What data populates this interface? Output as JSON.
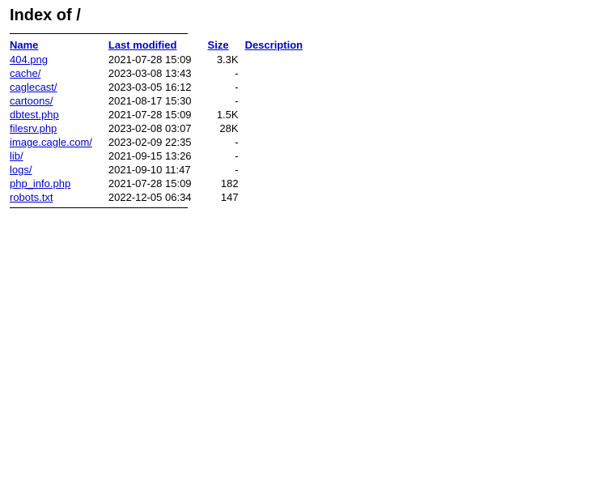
{
  "page": {
    "title": "Index of /"
  },
  "columns": {
    "name": "Name",
    "last_modified": "Last modified",
    "size": "Size",
    "description": "Description"
  },
  "files": [
    {
      "name": "404.png",
      "href": "404.png",
      "last_modified": "2021-07-28 15:09",
      "size": "3.3K",
      "description": ""
    },
    {
      "name": "cache/",
      "href": "cache/",
      "last_modified": "2023-03-08 13:43",
      "size": "-",
      "description": ""
    },
    {
      "name": "caglecast/",
      "href": "caglecast/",
      "last_modified": "2023-03-05 16:12",
      "size": "-",
      "description": ""
    },
    {
      "name": "cartoons/",
      "href": "cartoons/",
      "last_modified": "2021-08-17 15:30",
      "size": "-",
      "description": ""
    },
    {
      "name": "dbtest.php",
      "href": "dbtest.php",
      "last_modified": "2021-07-28 15:09",
      "size": "1.5K",
      "description": ""
    },
    {
      "name": "filesrv.php",
      "href": "filesrv.php",
      "last_modified": "2023-02-08 03:07",
      "size": "28K",
      "description": ""
    },
    {
      "name": "image.cagle.com/",
      "href": "image.cagle.com/",
      "last_modified": "2023-02-09 22:35",
      "size": "-",
      "description": ""
    },
    {
      "name": "lib/",
      "href": "lib/",
      "last_modified": "2021-09-15 13:26",
      "size": "-",
      "description": ""
    },
    {
      "name": "logs/",
      "href": "logs/",
      "last_modified": "2021-09-10 11:47",
      "size": "-",
      "description": ""
    },
    {
      "name": "php_info.php",
      "href": "php_info.php",
      "last_modified": "2021-07-28 15:09",
      "size": "182",
      "description": ""
    },
    {
      "name": "robots.txt",
      "href": "robots.txt",
      "last_modified": "2022-12-05 06:34",
      "size": "147",
      "description": ""
    }
  ]
}
